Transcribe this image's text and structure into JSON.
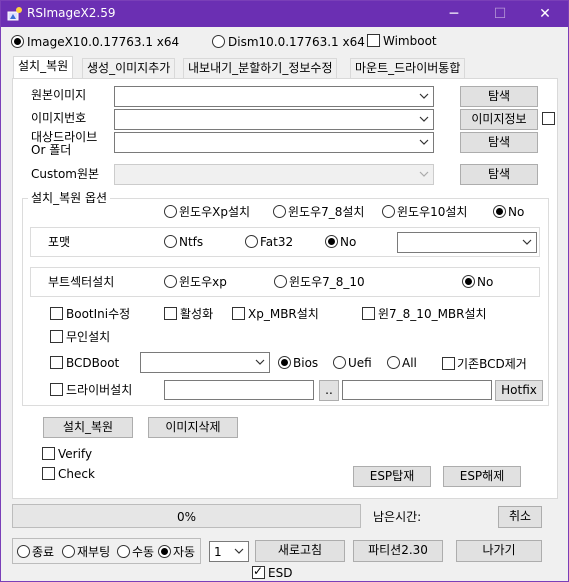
{
  "window": {
    "title": "RSImageX2.59",
    "minimize": "─",
    "maximize": "☐",
    "close": "✕"
  },
  "mode": {
    "imagex_label": "ImageX10.0.17763.1 x64",
    "imagex_selected": true,
    "dism_label": "Dism10.0.17763.1 x64",
    "dism_selected": false,
    "wimboot_label": "Wimboot",
    "wimboot_checked": false
  },
  "tabs": [
    {
      "label": "설치_복원",
      "active": true
    },
    {
      "label": "생성_이미지추가",
      "active": false
    },
    {
      "label": "내보내기_분할하기_정보수정",
      "active": false
    },
    {
      "label": "마운트_드라이버통합",
      "active": false
    }
  ],
  "source": {
    "original_image_label": "원본이미지",
    "original_image_value": "",
    "image_number_label": "이미지번호",
    "image_number_value": "",
    "target_drive_label_1": "대상드라이브",
    "target_drive_label_2": "Or 폴더",
    "target_drive_value": "",
    "custom_source_label": "Custom원본",
    "custom_source_value": "",
    "browse_label": "탐색",
    "image_info_label": "이미지정보",
    "image_info_checked": false
  },
  "options": {
    "group_label": "설치_복원 옵션",
    "install_os": [
      "윈도우Xp설치",
      "윈도우7_8설치",
      "윈도우10설치",
      "No"
    ],
    "install_os_selected": 3,
    "format_label": "포맷",
    "format_options": [
      "Ntfs",
      "Fat32",
      "No"
    ],
    "format_selected": 2,
    "format_combo_value": "",
    "bootsector_label": "부트섹터설치",
    "bootsector_options": [
      "윈도우xp",
      "윈도우7_8_10",
      "No"
    ],
    "bootsector_selected": 2,
    "bootini_label": "BootIni수정",
    "activate_label": "활성화",
    "xp_mbr_label": "Xp_MBR설치",
    "win7_mbr_label": "윈7_8_10_MBR설치",
    "unattended_label": "무인설치",
    "bcdboot_label": "BCDBoot",
    "bcdboot_combo_value": "",
    "firmware_options": [
      "Bios",
      "Uefi",
      "All"
    ],
    "firmware_selected": 0,
    "remove_bcd_label": "기존BCD제거",
    "driver_install_label": "드라이버설치",
    "driver_path_value": "",
    "ellipsis_label": "..",
    "hotfix_path_value": "",
    "hotfix_label": "Hotfix"
  },
  "actions": {
    "install_restore_label": "설치_복원",
    "delete_image_label": "이미지삭제",
    "verify_label": "Verify",
    "check_label": "Check",
    "esp_mount_label": "ESP탑재",
    "esp_unmount_label": "ESP해제"
  },
  "status": {
    "progress_percent": 0,
    "progress_text": "0%",
    "remaining_label": "남은시간:",
    "remaining_value": "",
    "cancel_label": "취소"
  },
  "footer": {
    "after_options": [
      "종료",
      "재부팅",
      "수동",
      "자동"
    ],
    "after_selected": 3,
    "count_value": "1",
    "refresh_label": "새로고침",
    "partition_label": "파티션2.30",
    "exit_label": "나가기",
    "esd_label": "ESD",
    "esd_checked": true
  },
  "colors": {
    "titlebar": "#6b2fb3",
    "window_bg": "#f0f0f0",
    "progress_fill": "#06b025"
  }
}
